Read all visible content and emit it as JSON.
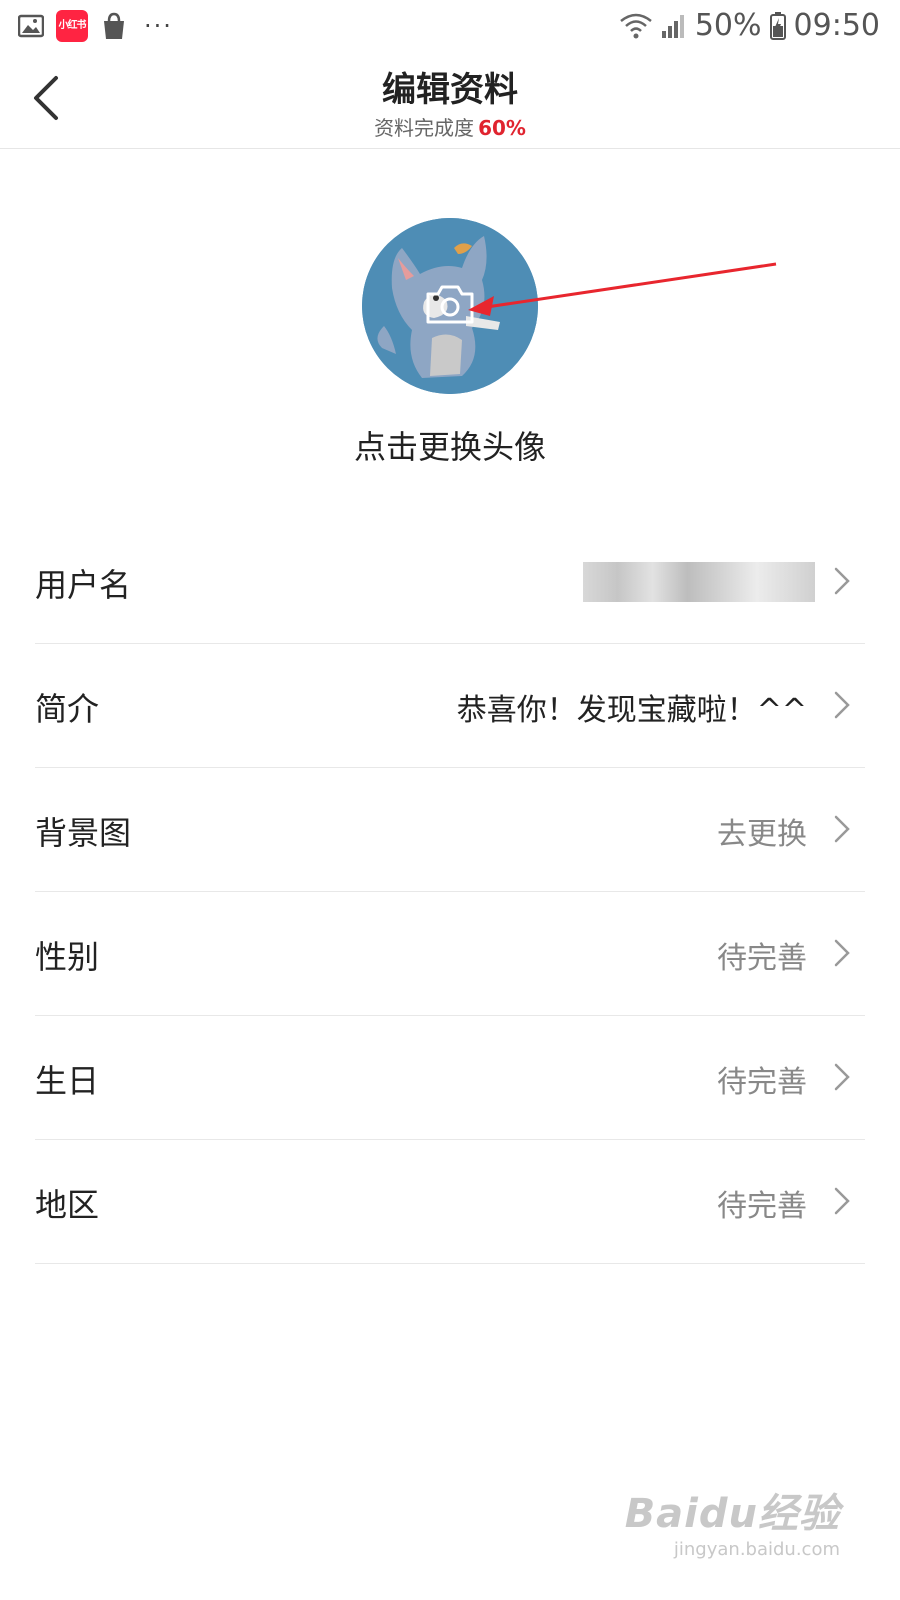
{
  "status_bar": {
    "app_badge": "小红书",
    "dots": "···",
    "battery": "50%",
    "time": "09:50"
  },
  "header": {
    "title": "编辑资料",
    "subtitle_prefix": "资料完成度",
    "completion": "60%"
  },
  "avatar": {
    "change_label": "点击更换头像"
  },
  "rows": [
    {
      "label": "用户名",
      "value": ""
    },
    {
      "label": "简介",
      "value": "恭喜你！发现宝藏啦！^^"
    },
    {
      "label": "背景图",
      "value": "去更换"
    },
    {
      "label": "性别",
      "value": "待完善"
    },
    {
      "label": "生日",
      "value": "待完善"
    },
    {
      "label": "地区",
      "value": "待完善"
    }
  ],
  "watermark": {
    "logo": "Baidu经验",
    "url": "jingyan.baidu.com"
  },
  "colors": {
    "accent_red": "#e0242f",
    "avatar_bg": "#4e8db5"
  }
}
